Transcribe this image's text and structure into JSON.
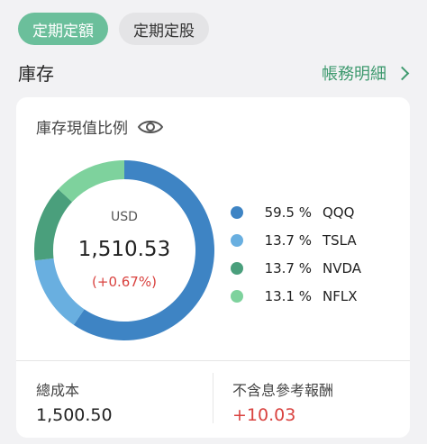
{
  "tabs": [
    {
      "label": "定期定額",
      "active": true
    },
    {
      "label": "定期定股",
      "active": false
    }
  ],
  "section": {
    "title": "庫存",
    "detail_link": "帳務明細"
  },
  "card": {
    "title": "庫存現值比例",
    "currency": "USD",
    "value": "1,510.53",
    "change": "(+0.67%)",
    "cost_label": "總成本",
    "cost_value": "1,500.50",
    "return_label": "不含息參考報酬",
    "return_value": "+10.03"
  },
  "chart_data": {
    "type": "pie",
    "categories": [
      "QQQ",
      "TSLA",
      "NVDA",
      "NFLX"
    ],
    "values": [
      59.5,
      13.7,
      13.7,
      13.1
    ],
    "labels": [
      "59.5 %",
      "13.7 %",
      "13.7 %",
      "13.1 %"
    ],
    "colors": [
      "#3e84c4",
      "#69afe0",
      "#4a9f7c",
      "#7ed29d"
    ]
  },
  "colors": {
    "accent_tab": "#6bbf9b",
    "link": "#3f9a6f",
    "positive": "#d9423f"
  }
}
